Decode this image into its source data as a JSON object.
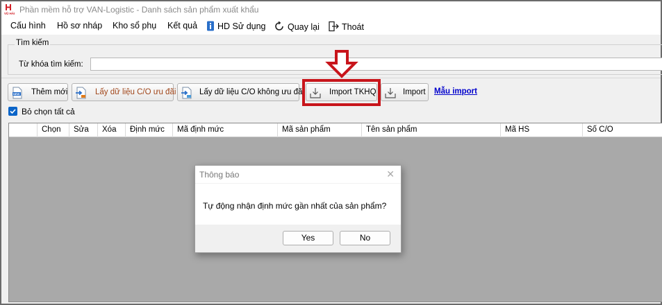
{
  "window": {
    "title": "Phần mềm hỗ trợ VAN-Logistic - Danh sách sản phẩm xuất khẩu",
    "logo_text": "VŨ HẢI",
    "logo_color": "#d21f26"
  },
  "menu": {
    "items": [
      {
        "label": "Cấu hình"
      },
      {
        "label": "Hồ sơ nháp"
      },
      {
        "label": "Kho sổ phụ"
      },
      {
        "label": "Kết quả"
      },
      {
        "label": "HD Sử dụng",
        "icon": "info-icon"
      },
      {
        "label": "Quay lại",
        "icon": "refresh-icon"
      },
      {
        "label": "Thoát",
        "icon": "exit-icon"
      }
    ]
  },
  "search": {
    "group_label": "Tìm kiếm",
    "keyword_label": "Từ khóa tìm kiếm:",
    "keyword_value": ""
  },
  "toolbar": {
    "add_new": "Thêm mới",
    "get_co_preferential": "Lấy dữ liệu C/O ưu đãi",
    "get_co_non_preferential": "Lấy dữ liệu C/O không ưu đãi",
    "import_tkhq": "Import TKHQ",
    "import": "Import",
    "import_template": "Mẫu import"
  },
  "select_all": {
    "label": "Bỏ chọn tất cả",
    "checked": true
  },
  "grid": {
    "columns": [
      "Chọn",
      "Sửa",
      "Xóa",
      "Định mức",
      "Mã định mức",
      "Mã sản phẩm",
      "Tên sản phẩm",
      "Mã HS",
      "Số C/O"
    ],
    "rows": []
  },
  "dialog": {
    "title": "Thông báo",
    "message": "Tự động nhận định mức gần nhất của sản phẩm?",
    "yes_label": "Yes",
    "no_label": "No"
  },
  "colors": {
    "highlight": "#c8151b",
    "accent": "#0a64c8",
    "link": "#0000cc"
  }
}
